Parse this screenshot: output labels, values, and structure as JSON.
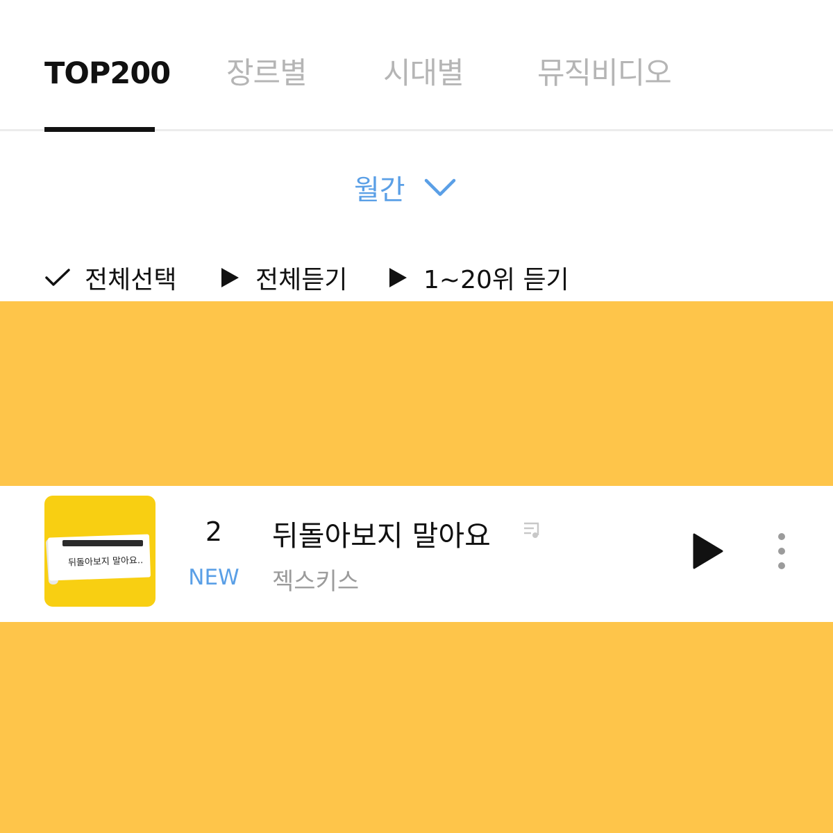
{
  "tabs": [
    {
      "label": "TOP200",
      "selected": true
    },
    {
      "label": "장르별",
      "selected": false
    },
    {
      "label": "시대별",
      "selected": false
    },
    {
      "label": "뮤직비디오",
      "selected": false
    }
  ],
  "period": {
    "label": "월간",
    "icon": "chevron-down-icon"
  },
  "actions": {
    "select_all": {
      "label": "전체선택",
      "icon": "check-icon"
    },
    "play_all": {
      "label": "전체듣기",
      "icon": "play-icon"
    },
    "play_top20": {
      "label": "1~20위 듣기",
      "icon": "play-icon"
    }
  },
  "track": {
    "rank": "2",
    "badge": "NEW",
    "title": "뒤돌아보지 말아요",
    "artist": "젝스키스",
    "cover_text": "뒤돌아보지 말아요..",
    "lyrics_icon": "lyrics-icon",
    "play_icon": "play-icon",
    "more_icon": "more-vertical-icon"
  },
  "colors": {
    "accent_blue": "#5a9fe6",
    "band_yellow": "#fec54a",
    "cover_yellow": "#f8cf12",
    "inactive_tab": "#b5b5b5",
    "artist_gray": "#9b9b9b"
  }
}
